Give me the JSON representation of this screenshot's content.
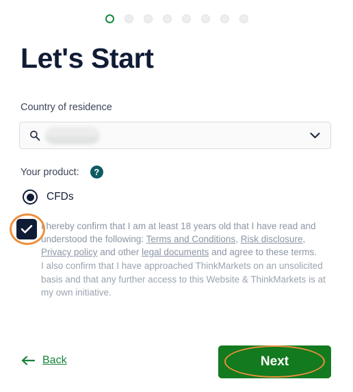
{
  "stepper": {
    "total_steps": 8,
    "active_index": 0,
    "active_color": "#12893b",
    "inactive_color": "#eeeeee"
  },
  "header": {
    "title": "Let's Start"
  },
  "country_field": {
    "label": "Country of residence",
    "value": "",
    "value_redacted": true,
    "placeholder": "",
    "search_icon": "search-icon",
    "chevron_icon": "chevron-down-icon"
  },
  "product": {
    "label": "Your product:",
    "help_icon": "question-mark-icon",
    "help_icon_glyph": "?",
    "help_icon_color": "#0f5b62",
    "options": [
      {
        "label": "CFDs",
        "selected": true
      }
    ]
  },
  "consent": {
    "checked": true,
    "check_glyph": "check-icon",
    "paragraph_1": {
      "part_1": "I hereby confirm that I am at least 18 years old that I have read and understood the following: ",
      "link_1": "Terms and Conditions",
      "sep_1": ", ",
      "link_2": "Risk disclosure",
      "sep_2": ", ",
      "link_3": "Privacy policy",
      "sep_3": " and other ",
      "link_4": "legal documents",
      "part_end": " and agree to these terms."
    },
    "paragraph_2": "I also confirm that I have approached ThinkMarkets on an unsolicited basis and that any further access to this Website & ThinkMarkets is at my own initiative."
  },
  "footer": {
    "back_label": "Back",
    "back_icon": "arrow-left-icon",
    "next_label": "Next",
    "next_color": "#137a1f",
    "back_color": "#17823a"
  },
  "annotations": {
    "color": "#ef8f3c",
    "highlighted": [
      "consent-checkbox",
      "next-button"
    ]
  }
}
